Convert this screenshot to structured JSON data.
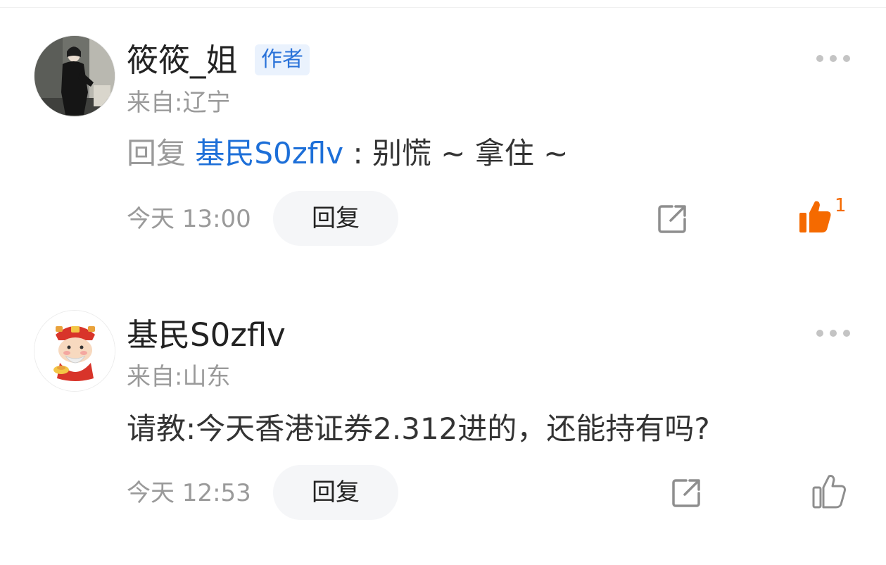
{
  "comments": [
    {
      "username": "筱筱_姐",
      "badge": "作者",
      "location": "来自:辽宁",
      "reply_prefix": "回复 ",
      "mention": "基民S0zflv",
      "text": " : 别慌 ~ 拿住 ~",
      "time": "今天 13:00",
      "reply_label": "回复",
      "like_count": "1",
      "liked": true,
      "avatar_icon": "photo-avatar"
    },
    {
      "username": "基民S0zflv",
      "location": "来自:山东",
      "text": "请教:今天香港证券2.312进的，还能持有吗?",
      "time": "今天 12:53",
      "reply_label": "回复",
      "liked": false,
      "avatar_icon": "fortune-god-avatar"
    }
  ],
  "colors": {
    "accent_blue": "#1d6fd8",
    "like_orange": "#f56a00",
    "muted_gray": "#9a9a9a"
  }
}
